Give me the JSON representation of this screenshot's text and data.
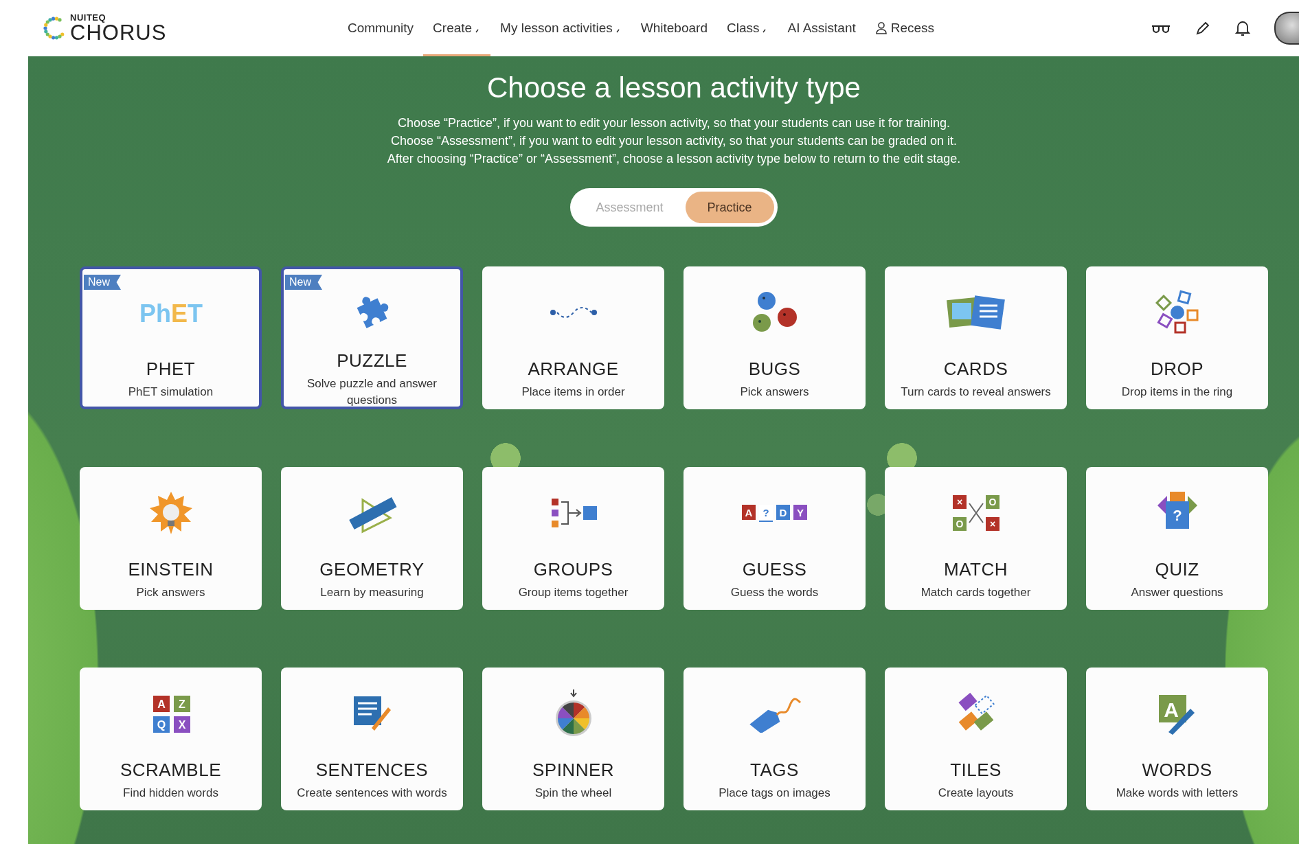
{
  "logo": {
    "brand": "NUITEQ",
    "product": "CHORUS"
  },
  "nav": [
    {
      "label": "Community",
      "selected": false,
      "has_menu": false,
      "kind": "plain"
    },
    {
      "label": "Create",
      "selected": true,
      "has_menu": true,
      "kind": "plain"
    },
    {
      "label": "My lesson activities",
      "selected": false,
      "has_menu": true,
      "kind": "plain"
    },
    {
      "label": "Whiteboard",
      "selected": false,
      "has_menu": false,
      "kind": "plain"
    },
    {
      "label": "Class",
      "selected": false,
      "has_menu": true,
      "kind": "plain"
    },
    {
      "label": "AI Assistant",
      "selected": false,
      "has_menu": false,
      "kind": "plain"
    },
    {
      "label": "Recess",
      "selected": false,
      "has_menu": false,
      "kind": "person"
    }
  ],
  "heading": "Choose a lesson activity type",
  "description": [
    "Choose “Practice”, if you want to edit your lesson activity, so that your students can use it for training.",
    "Choose “Assessment”, if you want to edit your lesson activity, so that your students can be graded on it.",
    "After choosing “Practice” or “Assessment”, choose a lesson activity type below to return to the edit stage."
  ],
  "mode_toggle": [
    {
      "label": "Assessment",
      "selected": false
    },
    {
      "label": "Practice",
      "selected": true
    }
  ],
  "cards": [
    {
      "kind": "phet",
      "title": "PHET",
      "subtitle": "PhET simulation",
      "badge": "New",
      "icon_text": [
        "Ph",
        "ET"
      ]
    },
    {
      "kind": "puzzle",
      "title": "PUZZLE",
      "subtitle": "Solve puzzle and answer questions",
      "badge": "New"
    },
    {
      "kind": "arrange",
      "title": "ARRANGE",
      "subtitle": "Place items in order"
    },
    {
      "kind": "bugs",
      "title": "BUGS",
      "subtitle": "Pick answers"
    },
    {
      "kind": "cards",
      "title": "CARDS",
      "subtitle": "Turn cards to reveal answers"
    },
    {
      "kind": "drop",
      "title": "DROP",
      "subtitle": "Drop items in the ring"
    },
    {
      "kind": "einstein",
      "title": "EINSTEIN",
      "subtitle": "Pick answers"
    },
    {
      "kind": "geometry",
      "title": "GEOMETRY",
      "subtitle": "Learn by measuring"
    },
    {
      "kind": "groups",
      "title": "GROUPS",
      "subtitle": "Group items together"
    },
    {
      "kind": "guess",
      "title": "GUESS",
      "subtitle": "Guess the words",
      "icon_text": [
        "A",
        "?",
        "D",
        "Y"
      ]
    },
    {
      "kind": "match",
      "title": "MATCH",
      "subtitle": "Match cards together",
      "icon_text": [
        "×",
        "O",
        "O",
        "×"
      ]
    },
    {
      "kind": "quiz",
      "title": "QUIZ",
      "subtitle": "Answer questions",
      "icon_text": [
        "?"
      ]
    },
    {
      "kind": "scramble",
      "title": "SCRAMBLE",
      "subtitle": "Find hidden words",
      "icon_text": [
        "A",
        "Z",
        "Q",
        "X"
      ]
    },
    {
      "kind": "sentences",
      "title": "SENTENCES",
      "subtitle": "Create sentences with words"
    },
    {
      "kind": "spinner",
      "title": "SPINNER",
      "subtitle": "Spin the wheel"
    },
    {
      "kind": "tags",
      "title": "TAGS",
      "subtitle": "Place tags on images"
    },
    {
      "kind": "tiles",
      "title": "TILES",
      "subtitle": "Create layouts"
    },
    {
      "kind": "words",
      "title": "WORDS",
      "subtitle": "Make words with letters",
      "icon_text": [
        "A"
      ]
    }
  ]
}
